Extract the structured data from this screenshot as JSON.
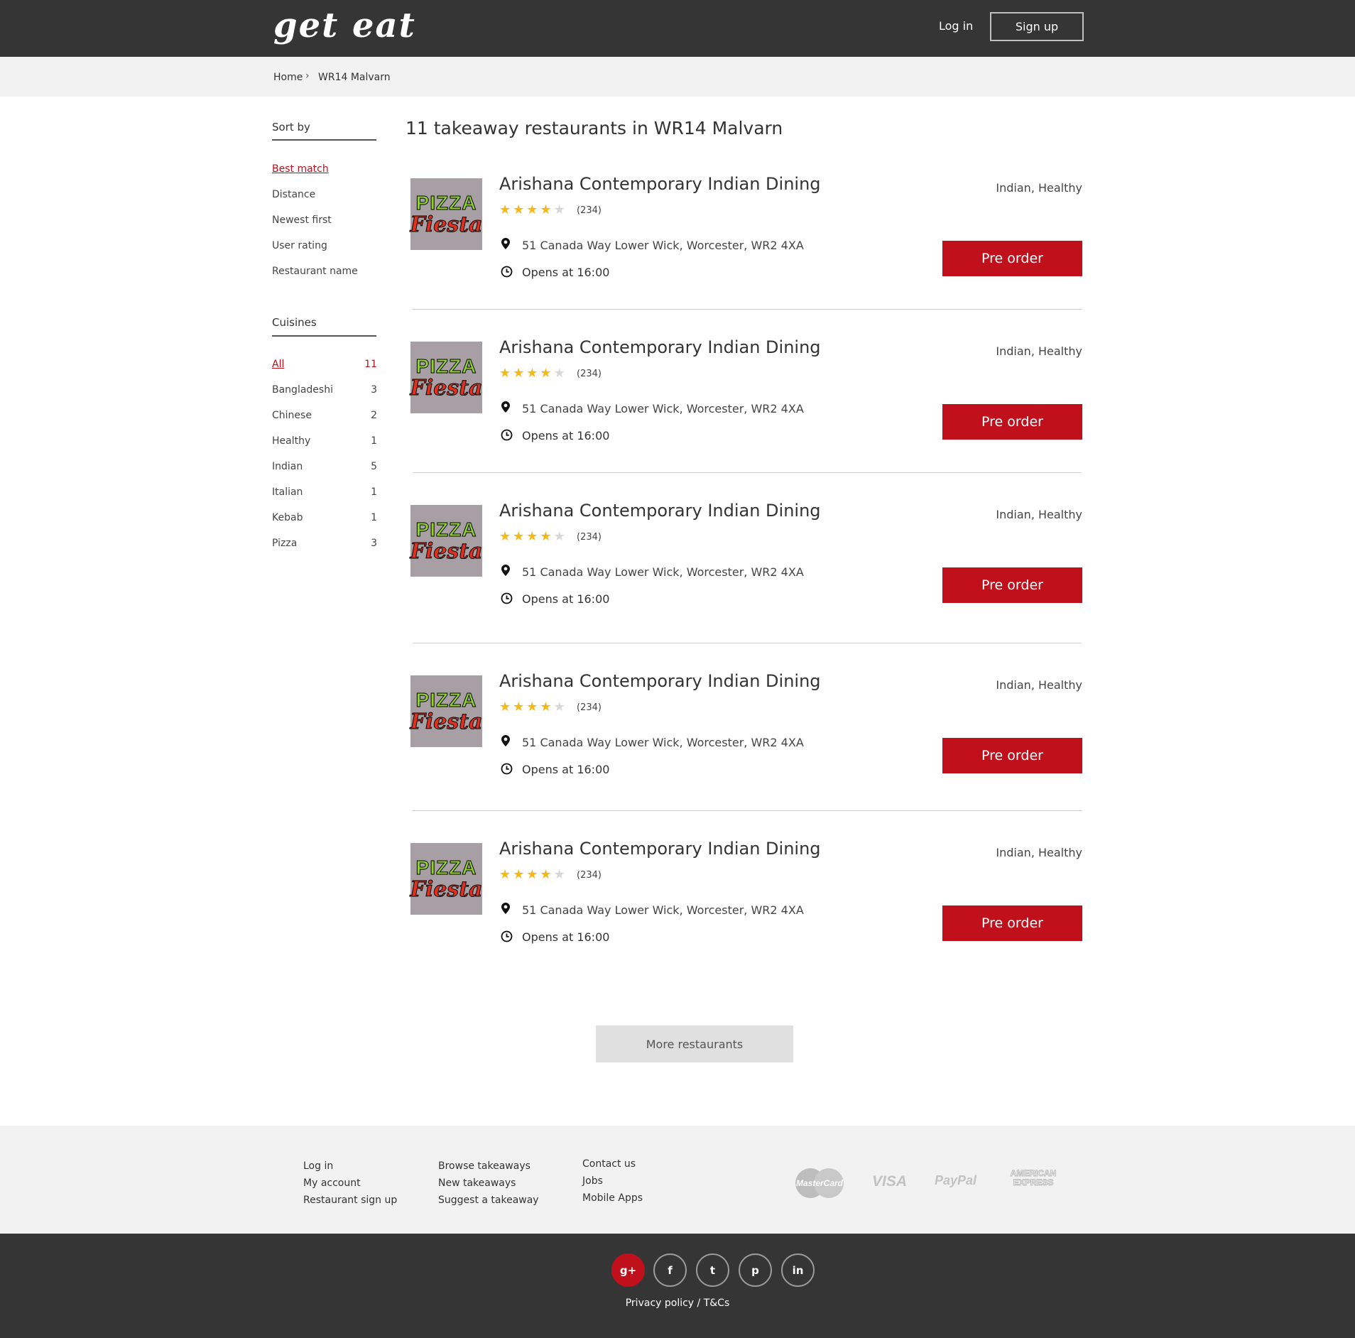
{
  "header": {
    "logo": "get eat",
    "login": "Log in",
    "signup": "Sign up"
  },
  "breadcrumb": {
    "home": "Home",
    "current": "WR14 Malvarn"
  },
  "sidebar": {
    "sort_title": "Sort by",
    "sort_options": [
      "Best match",
      "Distance",
      "Newest first",
      "User rating",
      "Restaurant name"
    ],
    "sort_selected": "Best match",
    "cuisines_title": "Cuisines",
    "cuisines": [
      {
        "label": "All",
        "count": "11"
      },
      {
        "label": "Bangladeshi",
        "count": "3"
      },
      {
        "label": "Chinese",
        "count": "2"
      },
      {
        "label": "Healthy",
        "count": "1"
      },
      {
        "label": "Indian",
        "count": "5"
      },
      {
        "label": "Italian",
        "count": "1"
      },
      {
        "label": "Kebab",
        "count": "1"
      },
      {
        "label": "Pizza",
        "count": "3"
      }
    ],
    "cuisine_selected": "All"
  },
  "main": {
    "title": "11 takeaway restaurants in WR14 Malvarn",
    "restaurants": [
      {
        "logo_top": "PIZZA",
        "logo_bottom": "Fiesta",
        "name": "Arishana Contemporary Indian Dining",
        "rating": 4,
        "max_rating": 5,
        "reviews": "(234)",
        "address": "51 Canada Way Lower Wick, Worcester, WR2 4XA",
        "opens": "Opens at 16:00",
        "cuisines": "Indian, Healthy",
        "button": "Pre order"
      },
      {
        "logo_top": "PIZZA",
        "logo_bottom": "Fiesta",
        "name": "Arishana Contemporary Indian Dining",
        "rating": 4,
        "max_rating": 5,
        "reviews": "(234)",
        "address": "51 Canada Way Lower Wick, Worcester, WR2 4XA",
        "opens": "Opens at 16:00",
        "cuisines": "Indian, Healthy",
        "button": "Pre order"
      },
      {
        "logo_top": "PIZZA",
        "logo_bottom": "Fiesta",
        "name": "Arishana Contemporary Indian Dining",
        "rating": 4,
        "max_rating": 5,
        "reviews": "(234)",
        "address": "51 Canada Way Lower Wick, Worcester, WR2 4XA",
        "opens": "Opens at 16:00",
        "cuisines": "Indian, Healthy",
        "button": "Pre order"
      },
      {
        "logo_top": "PIZZA",
        "logo_bottom": "Fiesta",
        "name": "Arishana Contemporary Indian Dining",
        "rating": 4,
        "max_rating": 5,
        "reviews": "(234)",
        "address": "51 Canada Way Lower Wick, Worcester, WR2 4XA",
        "opens": "Opens at 16:00",
        "cuisines": "Indian, Healthy",
        "button": "Pre order"
      },
      {
        "logo_top": "PIZZA",
        "logo_bottom": "Fiesta",
        "name": "Arishana Contemporary Indian Dining",
        "rating": 4,
        "max_rating": 5,
        "reviews": "(234)",
        "address": "51 Canada Way Lower Wick, Worcester, WR2 4XA",
        "opens": "Opens at 16:00",
        "cuisines": "Indian, Healthy",
        "button": "Pre order"
      }
    ],
    "more_button": "More restaurants"
  },
  "footer": {
    "col1": [
      "Log in",
      "My account",
      "Restaurant sign up"
    ],
    "col2": [
      "Browse takeaways",
      "New takeaways",
      "Suggest a takeaway"
    ],
    "col3": [
      "Contact us",
      "Jobs",
      "Mobile Apps"
    ],
    "payments": {
      "mastercard": "MasterCard",
      "visa": "VISA",
      "paypal": "PayPal",
      "amex_line1": "AMERICAN",
      "amex_line2": "EXPRESS"
    },
    "social": [
      {
        "icon": "google-plus-icon",
        "glyph": "g+"
      },
      {
        "icon": "facebook-icon",
        "glyph": "f"
      },
      {
        "icon": "twitter-icon",
        "glyph": "t"
      },
      {
        "icon": "pinterest-icon",
        "glyph": "p"
      },
      {
        "icon": "linkedin-icon",
        "glyph": "in"
      }
    ],
    "privacy": "Privacy policy / T&Cs"
  },
  "colors": {
    "header_bg": "#353535",
    "accent": "#c0101c",
    "star": "#f6b817",
    "footer_bg": "#f2f2f2"
  }
}
